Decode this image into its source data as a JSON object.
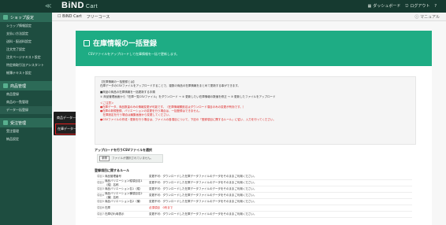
{
  "header": {
    "logo": "BiND",
    "logo_sub": "Cart",
    "collapse_glyph": "≪",
    "links": [
      {
        "icon": "dashboard-icon",
        "label": "ダッシュボード"
      },
      {
        "icon": "logout-icon",
        "label": "ログアウト"
      },
      {
        "icon": "menu-icon",
        "label": "?"
      }
    ]
  },
  "breadcrumb": {
    "items": [
      "BiND Cart",
      "フリーコース"
    ],
    "manual": "マニュアル"
  },
  "sidebar": {
    "sections": [
      {
        "label": "ショップ設定",
        "items": [
          "ショップ情報設定",
          "支払い方法設定",
          "送料・配送料設定",
          "注文完了設定",
          "注文ページテキスト設定",
          "特定商取引法アシスタント",
          "帳簿テキスト設定"
        ]
      },
      {
        "label": "商品管理",
        "items": [
          "商品登録",
          "商品の一覧管理",
          "データ一括登録"
        ]
      },
      {
        "label": "受注管理",
        "items": [
          "受注管理",
          "納品設定"
        ]
      }
    ]
  },
  "submenu": {
    "items": [
      "商品データ一括登録",
      "在庫データ一括登録"
    ],
    "highlighted_index": 1
  },
  "hero": {
    "title": "在庫情報の一括登録",
    "description": "CSVファイルをアップロードして在庫情報を一括で更新します。"
  },
  "info": {
    "lines": [
      {
        "text": "【在庫情報の一括登録とは】",
        "red": false
      },
      {
        "text": "在庫データのCSVファイルをアップロードすることで、複数の商品の在庫情報をまとめて更新する事ができます。",
        "red": false
      },
      {
        "text": "",
        "red": false
      },
      {
        "text": "■商品の商品の在庫情報を一括更新する手順",
        "red": false
      },
      {
        "text": "① 商品管理画面から「在庫一覧CSVファイル」をダウンロード → ② 更新したい在庫情報の数値を修正 → ③ 更新したファイルをアップロード",
        "red": false
      },
      {
        "text": "",
        "red": false
      },
      {
        "text": "＜ご注意＞",
        "red": true
      },
      {
        "text": "●在庫データ、商品数量のみの情報変更が可能です。（在庫情報欄設定はダウンロード項目のみの変更が有効です。）",
        "red": true
      },
      {
        "text": "●在庫の新規登録、バリエーションの変更を行う場合は、一括登録はできません。",
        "red": true
      },
      {
        "text": "　在庫設定を行う場合は編集画面から変更してください。",
        "red": true
      },
      {
        "text": "●CSVファイルの作成・更新を行う場合は、ファイルの各項目について、下記の「登録項目に関するルール」に従い、入力を行ってください。",
        "red": true
      }
    ]
  },
  "upload": {
    "label": "アップロードを行うCSVファイルを選択",
    "button": "参照",
    "placeholder": "ファイルが選択されていません。"
  },
  "rules": {
    "title": "登録項目に関するルール",
    "rows": [
      {
        "no": "項目1",
        "name": "商品管理番号",
        "rule": "変更不可：ダウンロードした在庫データファイルのデータをそのままご利用ください。",
        "red": false
      },
      {
        "no": "項目2",
        "name": "商品バリエーション縦項目名1（縦）名称",
        "rule": "変更不可：ダウンロードした在庫データファイルのデータをそのままご利用ください。",
        "red": false
      },
      {
        "no": "項目3",
        "name": "商品バリエーション名1（縦）",
        "rule": "変更不可：ダウンロードした在庫データファイルのデータをそのままご利用ください。",
        "red": false
      },
      {
        "no": "項目4",
        "name": "商品バリエーション横項目名2（横）名称",
        "rule": "変更不可：ダウンロードした在庫データファイルのデータをそのままご利用ください。",
        "red": false
      },
      {
        "no": "項目5",
        "name": "商品バリエーション名2（横）",
        "rule": "変更不可：ダウンロードした在庫データファイルのデータをそのままご利用ください。",
        "red": false
      },
      {
        "no": "項目6",
        "name": "在庫",
        "rule": "必須項目　0桁まで",
        "red": true
      },
      {
        "no": "項目7",
        "name": "在庫切れ時表示",
        "rule": "変更不可：ダウンロードした在庫データファイルのデータをそのままご利用ください。",
        "red": false
      }
    ]
  }
}
